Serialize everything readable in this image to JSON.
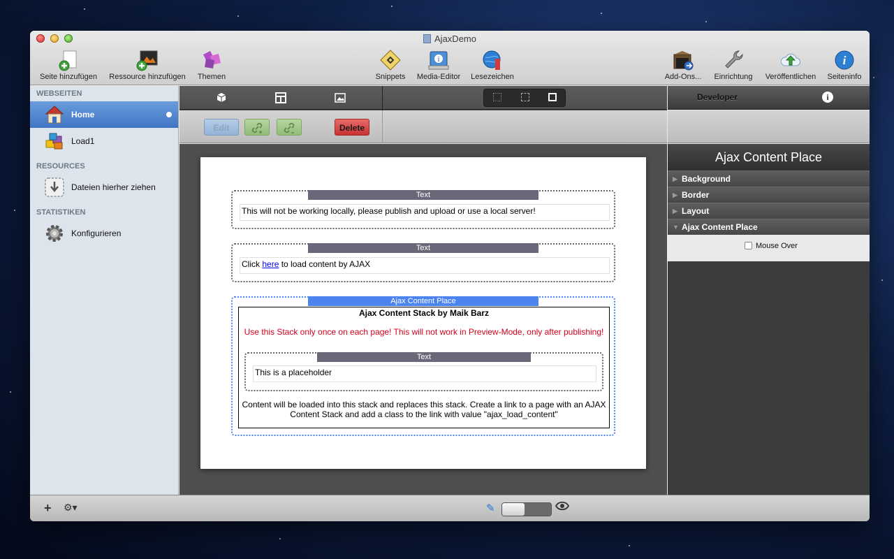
{
  "window": {
    "title": "AjaxDemo"
  },
  "toolbar": {
    "items": [
      {
        "label": "Seite hinzufügen",
        "icon": "add-page-icon"
      },
      {
        "label": "Ressource hinzufügen",
        "icon": "add-resource-icon"
      },
      {
        "label": "Themen",
        "icon": "themes-icon"
      },
      {
        "label": "Snippets",
        "icon": "snippets-icon"
      },
      {
        "label": "Media-Editor",
        "icon": "media-editor-icon"
      },
      {
        "label": "Lesezeichen",
        "icon": "bookmarks-icon"
      },
      {
        "label": "Add-Ons...",
        "icon": "addons-icon"
      },
      {
        "label": "Einrichtung",
        "icon": "setup-icon"
      },
      {
        "label": "Veröffentlichen",
        "icon": "publish-icon"
      },
      {
        "label": "Seiteninfo",
        "icon": "page-info-icon"
      }
    ]
  },
  "sidebar": {
    "sections": {
      "webseiten": "WEBSEITEN",
      "resources": "RESOURCES",
      "statistiken": "STATISTIKEN"
    },
    "pages": [
      {
        "label": "Home",
        "selected": true
      },
      {
        "label": "Load1",
        "selected": false
      }
    ],
    "resources_drop": "Dateien hierher ziehen",
    "stats_configure": "Konfigurieren"
  },
  "editor": {
    "buttons": {
      "edit": "Edit",
      "delete": "Delete"
    }
  },
  "content": {
    "stack_label": "Text",
    "stack1_text": "This will not be working locally, please publish and upload or use a local server!",
    "stack2_prefix": "Click ",
    "stack2_link": "here",
    "stack2_suffix": " to load content by AJAX",
    "acp_label": "Ajax Content Place",
    "acp_title": "Ajax Content Stack by Maik Barz",
    "acp_warning": "Use this Stack only once on each page! This will not work in Preview-Mode, only after publishing!",
    "inner_label": "Text",
    "inner_text": "This is a placeholder",
    "acp_footer": "Content will be loaded into this stack and replaces this stack. Create a link to a page with an AJAX Content Stack and add a class to the link with value \"ajax_load_content\""
  },
  "inspector": {
    "tab_title": "Developer",
    "panel_title": "Ajax Content Place",
    "sections": [
      "Background",
      "Border",
      "Layout",
      "Ajax Content Place"
    ],
    "checkbox_label": "Mouse Over"
  },
  "colors": {
    "selection": "#3f75c4",
    "acp_accent": "#4b83ef",
    "delete": "#c93232",
    "warning": "#d0021b"
  }
}
